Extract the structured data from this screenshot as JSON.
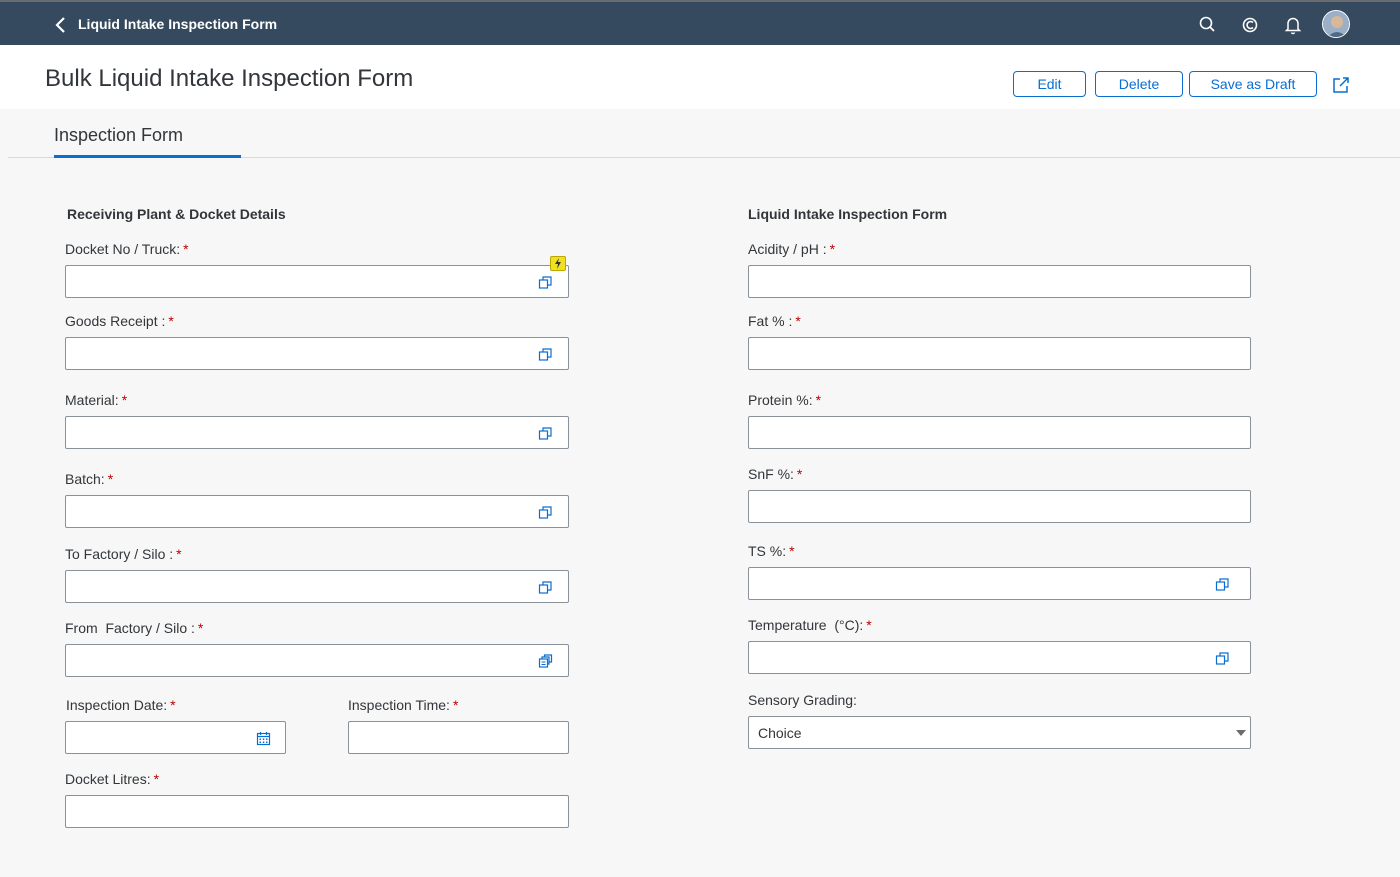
{
  "shell": {
    "title": "Liquid Intake Inspection Form"
  },
  "header": {
    "page_title": "Bulk Liquid Intake Inspection Form",
    "edit_label": "Edit",
    "delete_label": "Delete",
    "save_draft_label": "Save as Draft"
  },
  "tabs": [
    {
      "label": "Inspection Form",
      "selected": true
    }
  ],
  "left": {
    "title": "Receiving Plant & Docket Details",
    "fields": {
      "docket_no": {
        "label": "Docket No / Truck:",
        "value": ""
      },
      "goods_receipt": {
        "label": "Goods Receipt :",
        "value": ""
      },
      "material": {
        "label": "Material:",
        "value": ""
      },
      "batch": {
        "label": "Batch:",
        "value": ""
      },
      "to_factory": {
        "label": "To Factory / Silo :",
        "value": ""
      },
      "from_factory": {
        "label": "From  Factory / Silo :",
        "value": ""
      },
      "inspection_date": {
        "label": "Inspection Date:",
        "value": ""
      },
      "inspection_time": {
        "label": "Inspection Time:",
        "value": ""
      },
      "docket_litres": {
        "label": "Docket Litres:",
        "value": ""
      }
    }
  },
  "right": {
    "title": "Liquid Intake Inspection Form",
    "fields": {
      "acidity": {
        "label": "Acidity / pH :",
        "value": ""
      },
      "fat": {
        "label": "Fat % :",
        "value": ""
      },
      "protein": {
        "label": "Protein %:",
        "value": ""
      },
      "snf": {
        "label": "SnF %:",
        "value": ""
      },
      "ts": {
        "label": "TS %:",
        "value": ""
      },
      "temperature": {
        "label": "Temperature  (°C):",
        "value": ""
      },
      "sensory": {
        "label": "Sensory Grading:",
        "value": "Choice"
      }
    }
  },
  "required_marker": "*",
  "colors": {
    "shell_bg": "#354a5f",
    "accent": "#0a6ed1",
    "required": "#bb0000",
    "flash_badge": "#f0e020"
  },
  "icons": {
    "back": "chevron-left-icon",
    "search": "search-icon",
    "copilot": "copilot-icon",
    "notifications": "bell-icon",
    "share": "share-icon",
    "value_help": "value-help-icon",
    "calendar": "calendar-icon",
    "dropdown": "chevron-down-icon"
  }
}
